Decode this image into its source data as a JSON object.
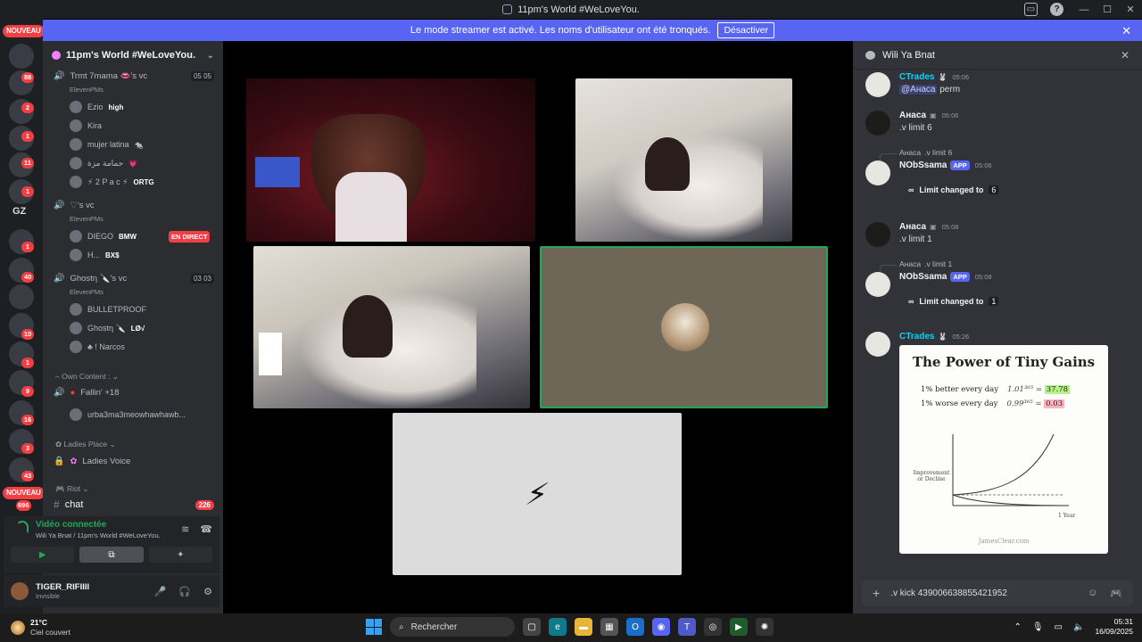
{
  "window": {
    "title": "11pm's World #WeLoveYou.",
    "controls": [
      "—",
      "☐",
      "✕"
    ]
  },
  "banner": {
    "text": "Le mode streamer est activé. Les noms d'utilisateur ont été tronqués.",
    "button": "Désactiver"
  },
  "rail": {
    "new_label_top": "NOUVEAU",
    "new_label_bottom": "NOUVEAU",
    "gz": "GZ",
    "badges": [
      "88",
      "2",
      "1",
      "11",
      "1",
      "1",
      "40",
      "10",
      "1",
      "9",
      "16",
      "3",
      "43",
      "696"
    ]
  },
  "sidebar": {
    "server_name": "11pm's World #WeLoveYou.",
    "voice1": {
      "name": "Trmt 7mama 👄's vc",
      "sub": "ElevenPMs",
      "count": "05 05"
    },
    "voice1_members": [
      {
        "name": "Ezio",
        "tag": "high"
      },
      {
        "name": "Kira",
        "tag": ""
      },
      {
        "name": "mujer latina",
        "tag": "🐀"
      },
      {
        "name": "حمامة مزة",
        "tag": "💗"
      },
      {
        "name": "⚡ 2 P a c ⚡",
        "tag": "ORTG"
      }
    ],
    "voice2": {
      "name": "♡'s vc",
      "sub": "ElevenPMs"
    },
    "voice2_members": [
      {
        "name": "DIEGO",
        "tag": "BMW"
      },
      {
        "name": "H...",
        "tag": "BX$"
      }
    ],
    "live_label": "EN DIRECT",
    "voice3": {
      "name": "Ghostη 🔪's vc",
      "sub": "ElevenPMs",
      "count": "03 03"
    },
    "voice3_members": [
      {
        "name": "BULLETPROOF",
        "tag": ""
      },
      {
        "name": "Ghostη 🔪",
        "tag": "LØ√"
      },
      {
        "name": "♣ ! Narcos",
        "tag": ""
      }
    ],
    "category_own": "Own Content :",
    "own_channels": [
      {
        "name": "Fallin' +18"
      },
      {
        "name": "urba3ma3meowhawhawb..."
      }
    ],
    "category_ladies": "Ladies Place",
    "ladies_voice": "Ladies Voice",
    "category_riot": "Riot",
    "chat_channel": "chat",
    "chat_count": "226"
  },
  "voice_panel": {
    "status": "Vidéo connectée",
    "location": "Wili Ya Bnat / 11pm's World #WeLoveYou."
  },
  "user_panel": {
    "name": "TIGER_RIFIIII",
    "status": "Invisible"
  },
  "chat": {
    "channel_name": "Wili Ya Bnat",
    "messages": [
      {
        "author": "CTrades",
        "time": "05:06",
        "mention": "@Анаса",
        "text": "perm"
      },
      {
        "author": "Анаса",
        "time": "05:06",
        "text": ".v limit 6"
      },
      {
        "reply_author": "Анаса",
        "reply_text": ".v limit 6",
        "author": "NObSsama",
        "app": "APP",
        "time": "05:06",
        "sys_text": "Limit changed to",
        "sys_num": "6"
      },
      {
        "author": "Анаса",
        "time": "05:08",
        "text": ".v limit 1"
      },
      {
        "reply_author": "Анаса",
        "reply_text": ".v limit 1",
        "author": "NObSsama",
        "app": "APP",
        "time": "05:08",
        "sys_text": "Limit changed to",
        "sys_num": "1"
      },
      {
        "author": "CTrades",
        "time": "05:26"
      }
    ],
    "card": {
      "title": "The Power of Tiny Gains",
      "line1": "1% better every day",
      "eq1": "1.01³⁶⁵ =",
      "res1": "37.78",
      "line2": "1% worse every day",
      "eq2": "0.99³⁶⁵ =",
      "res2": "0.03",
      "ylabel": "Improvement or Decline",
      "xlabel": "1 Year",
      "source": "JamesClear.com"
    },
    "composer_text": ".v kick 439006638855421952"
  },
  "taskbar": {
    "weather_temp": "21°C",
    "weather_desc": "Ciel couvert",
    "search_placeholder": "Rechercher",
    "time": "05:31",
    "date": "16/09/2025"
  }
}
